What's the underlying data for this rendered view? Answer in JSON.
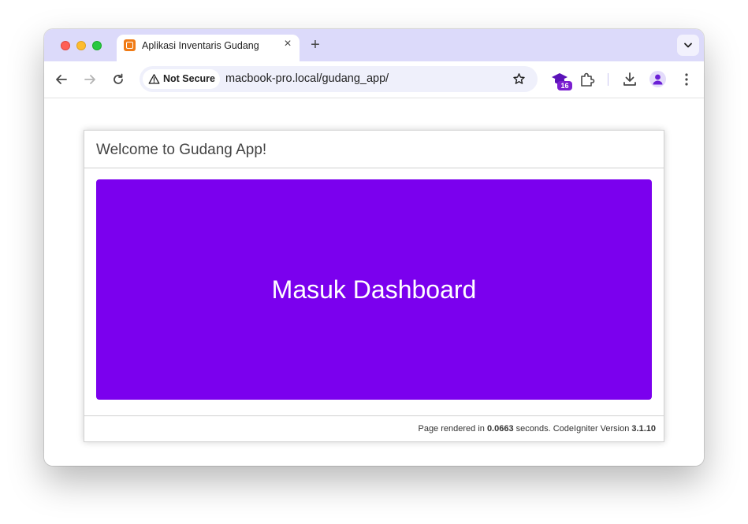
{
  "browser": {
    "tab": {
      "title": "Aplikasi Inventaris Gudang",
      "favicon": "codeigniter-flame-icon"
    },
    "new_tab_symbol": "+",
    "close_symbol": "×",
    "address_bar": {
      "security_label": "Not Secure",
      "url": "macbook-pro.local/gudang_app/"
    },
    "extension_badge": "16",
    "colors": {
      "tabstrip": "#dcdafa",
      "omnibox": "#eff0fb",
      "badge": "#7b1fd0"
    }
  },
  "page": {
    "heading": "Welcome to Gudang App!",
    "dashboard_button": "Masuk Dashboard",
    "footer": {
      "prefix": "Page rendered in ",
      "seconds": "0.0663",
      "middle": " seconds. CodeIgniter Version ",
      "version": "3.1.10"
    },
    "colors": {
      "button": "#7b00ee",
      "heading_text": "#444444"
    }
  }
}
